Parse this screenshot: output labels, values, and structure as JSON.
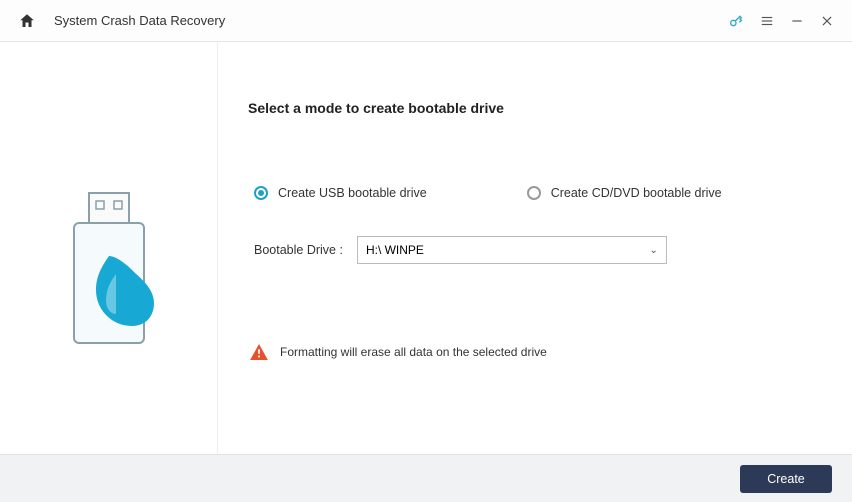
{
  "titlebar": {
    "title": "System Crash Data Recovery"
  },
  "main": {
    "heading": "Select a mode to create bootable drive",
    "option_usb": "Create USB bootable drive",
    "option_cd": "Create CD/DVD bootable drive",
    "drive_label": "Bootable Drive :",
    "drive_value": "H:\\ WINPE",
    "warning_text": "Formatting will erase all data on the selected drive"
  },
  "footer": {
    "create_label": "Create"
  },
  "colors": {
    "accent": "#1f9fc7",
    "warn": "#e8512e",
    "primary_btn": "#2c3a57"
  }
}
